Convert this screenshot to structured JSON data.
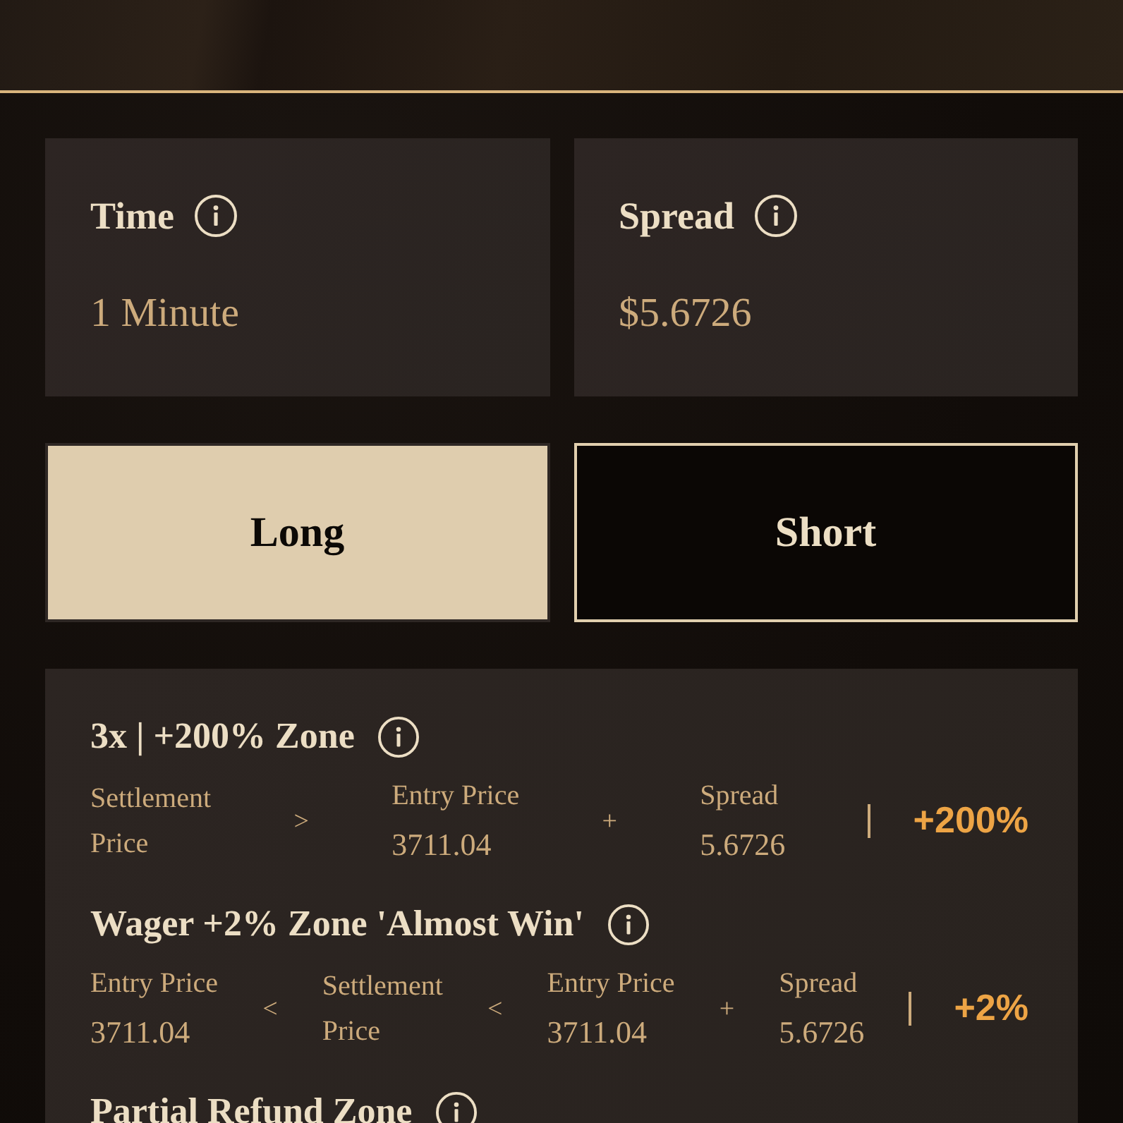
{
  "info_cards": [
    {
      "label": "Time",
      "value": "1 Minute"
    },
    {
      "label": "Spread",
      "value": "$5.6726"
    }
  ],
  "direction_buttons": [
    {
      "label": "Long",
      "selected": true
    },
    {
      "label": "Short",
      "selected": false
    }
  ],
  "zones": [
    {
      "title": "3x | +200% Zone",
      "formula": [
        {
          "kind": "term",
          "label": "Settlement Price"
        },
        {
          "kind": "operator",
          "text": ">"
        },
        {
          "kind": "term",
          "label": "Entry Price",
          "value": "3711.04"
        },
        {
          "kind": "operator",
          "text": "+"
        },
        {
          "kind": "term",
          "label": "Spread",
          "value": "5.6726"
        }
      ],
      "payout": "+200%"
    },
    {
      "title": "Wager +2% Zone 'Almost Win'",
      "formula": [
        {
          "kind": "term",
          "label": "Entry Price",
          "value": "3711.04"
        },
        {
          "kind": "operator",
          "text": "<"
        },
        {
          "kind": "term",
          "label": "Settlement Price"
        },
        {
          "kind": "operator",
          "text": "<"
        },
        {
          "kind": "term",
          "label": "Entry Price",
          "value": "3711.04"
        },
        {
          "kind": "operator",
          "text": "+"
        },
        {
          "kind": "term",
          "label": "Spread",
          "value": "5.6726"
        }
      ],
      "payout": "+2%"
    },
    {
      "title": "Partial Refund Zone"
    }
  ]
}
